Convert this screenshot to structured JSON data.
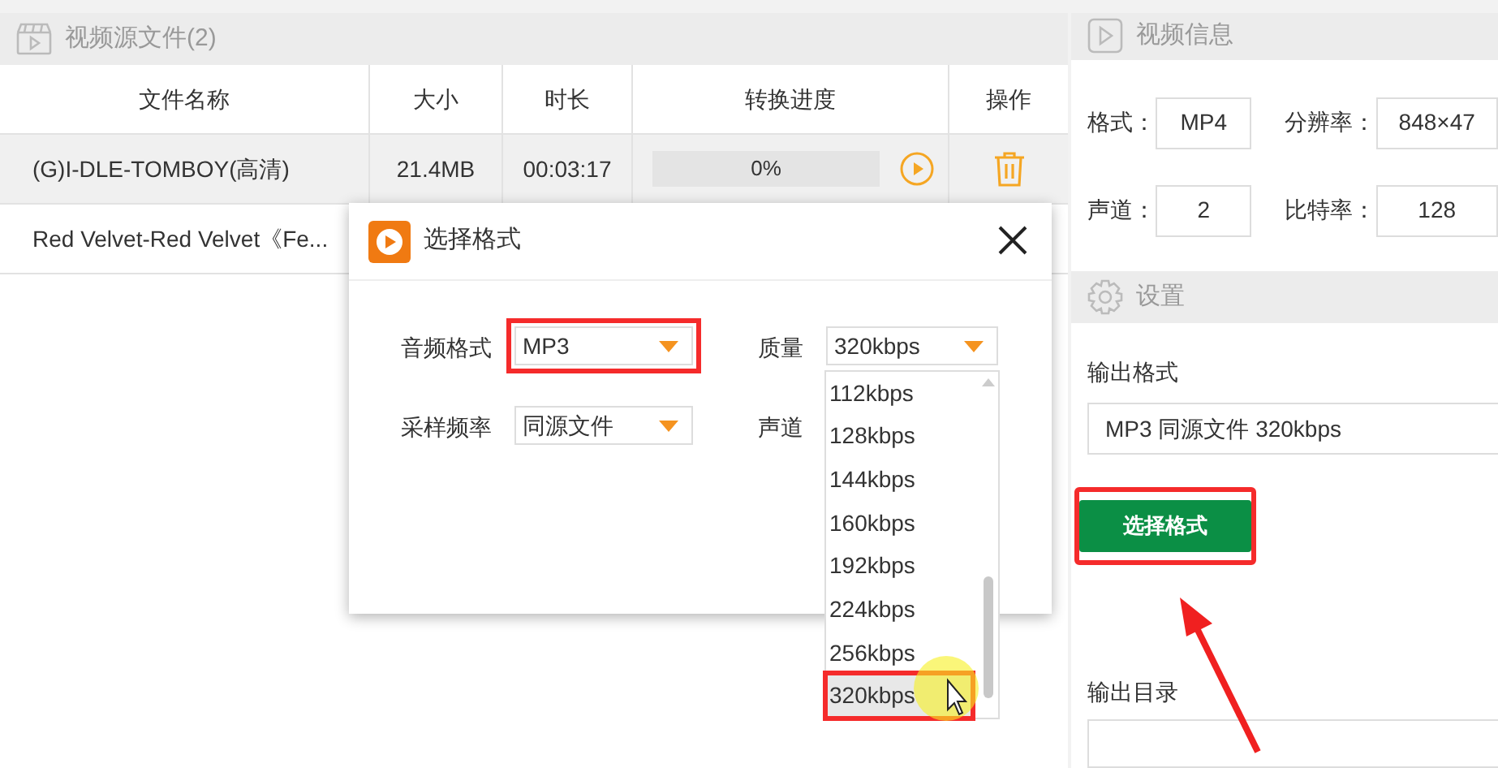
{
  "source_panel": {
    "title": "视频源文件(2)",
    "columns": [
      "文件名称",
      "大小",
      "时长",
      "转换进度",
      "操作"
    ],
    "rows": [
      {
        "name": "(G)I-DLE-TOMBOY(高清)",
        "size": "21.4MB",
        "duration": "00:03:17",
        "progress_text": "0%",
        "level": 0,
        "selected": true
      },
      {
        "name": "Red Velvet-Red Velvet《Fe...",
        "selected": false
      }
    ]
  },
  "dialog": {
    "title": "选择格式",
    "fields": [
      {
        "label": "音频格式",
        "value": "MP3",
        "highlighted": true
      },
      {
        "label": "质量",
        "value": "320kbps"
      },
      {
        "label": "采样频率",
        "value": "同源文件"
      },
      {
        "label": "声道"
      }
    ],
    "quality_options": [
      {
        "label": "112kbps",
        "selected": false
      },
      {
        "label": "128kbps",
        "selected": false
      },
      {
        "label": "144kbps",
        "selected": false
      },
      {
        "label": "160kbps",
        "selected": false
      },
      {
        "label": "192kbps",
        "selected": false
      },
      {
        "label": "224kbps",
        "selected": false
      },
      {
        "label": "256kbps",
        "selected": false
      },
      {
        "label": "320kbps",
        "selected": true,
        "highlighted": true
      }
    ]
  },
  "video_info": {
    "title": "视频信息",
    "fields": [
      {
        "label": "格式：",
        "value": "MP4"
      },
      {
        "label": "分辨率：",
        "value": "848×47"
      },
      {
        "label": "声道：",
        "value": "2"
      },
      {
        "label": "比特率：",
        "value": "128"
      }
    ]
  },
  "settings": {
    "title": "设置",
    "output_format_label": "输出格式",
    "output_format": "MP3 同源文件 320kbps",
    "choose_button": {
      "label": "选择格式",
      "highlighted": true
    },
    "output_dir_label": "输出目录"
  }
}
